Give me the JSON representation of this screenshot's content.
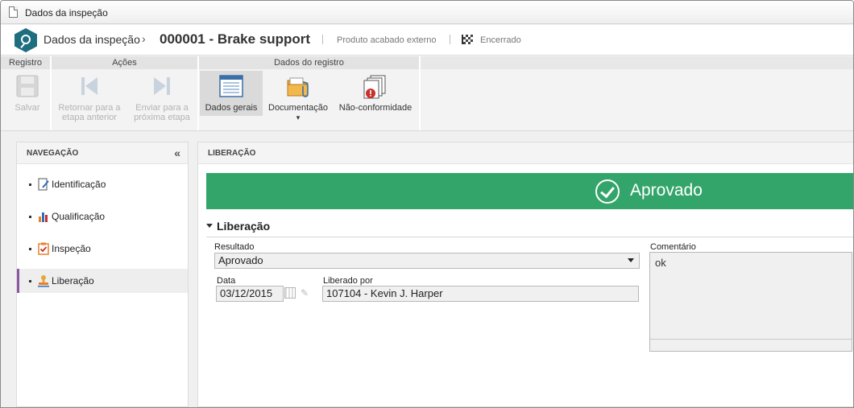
{
  "window": {
    "title": "Dados da inspeção"
  },
  "header": {
    "breadcrumb_root": "Dados da inspeção",
    "separator": "›",
    "record_title": "000001 - Brake support",
    "product_type": "Produto acabado externo",
    "status": "Encerrado"
  },
  "ribbon": {
    "groups": {
      "registro": "Registro",
      "acoes": "Ações",
      "dados_registro": "Dados do registro"
    },
    "buttons": {
      "salvar": {
        "line1": "Salvar",
        "line2": ""
      },
      "retornar": {
        "line1": "Retornar para a",
        "line2": "etapa anterior"
      },
      "enviar": {
        "line1": "Enviar para a",
        "line2": "próxima etapa"
      },
      "dados_gerais": {
        "line1": "Dados gerais",
        "line2": ""
      },
      "documentacao": {
        "line1": "Documentação",
        "line2": "▾"
      },
      "nao_conformidade": {
        "line1": "Não-conformidade",
        "line2": ""
      }
    }
  },
  "navigation": {
    "title": "NAVEGAÇÃO",
    "collapse_glyph": "«",
    "items": [
      {
        "label": "Identificação",
        "icon": "edit-document-icon"
      },
      {
        "label": "Qualificação",
        "icon": "bar-chart-icon"
      },
      {
        "label": "Inspeção",
        "icon": "checklist-icon"
      },
      {
        "label": "Liberação",
        "icon": "stamp-icon",
        "selected": true
      }
    ]
  },
  "content": {
    "title": "LIBERAÇÃO",
    "banner": {
      "text": "Aprovado",
      "color": "#33a56a"
    },
    "section_title": "Liberação",
    "fields": {
      "resultado": {
        "label": "Resultado",
        "value": "Aprovado"
      },
      "data": {
        "label": "Data",
        "value": "03/12/2015"
      },
      "liberado_por": {
        "label": "Liberado por",
        "value": "107104 - Kevin J. Harper"
      },
      "comentario": {
        "label": "Comentário",
        "value": "ok"
      }
    }
  },
  "colors": {
    "accent": "#1e6e80",
    "approved": "#33a56a",
    "selected_nav_border": "#8a5aa0"
  }
}
